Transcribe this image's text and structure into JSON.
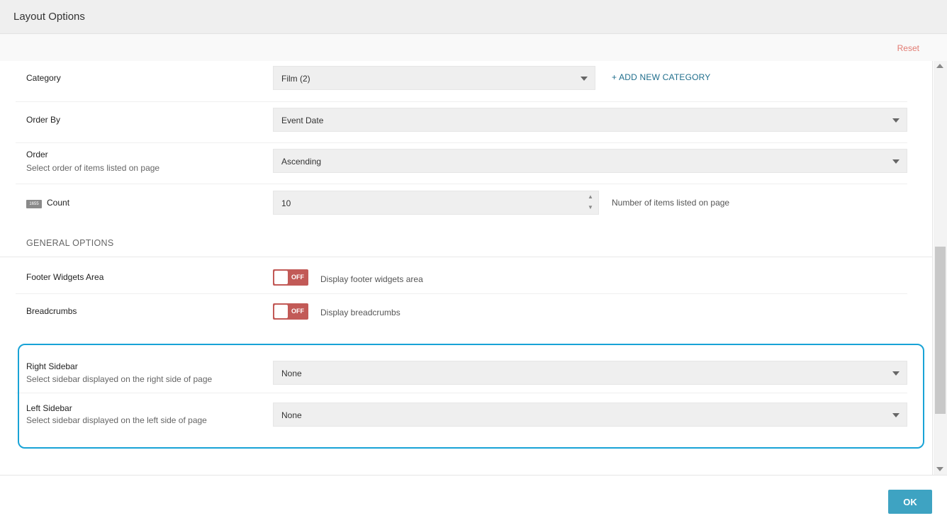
{
  "header": {
    "title": "Layout Options"
  },
  "toolbar": {
    "reset_label": "Reset"
  },
  "fields": {
    "category": {
      "label": "Category",
      "value": "Film  (2)",
      "add_label": "+ ADD NEW CATEGORY"
    },
    "order_by": {
      "label": "Order By",
      "value": "Event Date"
    },
    "order": {
      "label": "Order",
      "description": "Select order of items listed on page",
      "value": "Ascending"
    },
    "count": {
      "icon": "number-icon",
      "icon_text": "1655",
      "label": "Count",
      "value": "10",
      "note": "Number of items listed on page"
    }
  },
  "general_options": {
    "title": "GENERAL OPTIONS",
    "footer_widgets": {
      "label": "Footer Widgets Area",
      "state": "OFF",
      "description": "Display footer widgets area"
    },
    "breadcrumbs": {
      "label": "Breadcrumbs",
      "state": "OFF",
      "description": "Display breadcrumbs"
    }
  },
  "sidebars": {
    "right": {
      "label": "Right Sidebar",
      "description": "Select sidebar displayed on the right side of page",
      "value": "None"
    },
    "left": {
      "label": "Left Sidebar",
      "description": "Select sidebar displayed on the left side of page",
      "value": "None"
    }
  },
  "footer": {
    "ok_label": "OK"
  },
  "colors": {
    "accent": "#3ea3c2",
    "toggle_off": "#c25a57",
    "highlight": "#18a3d6",
    "link": "#1f6e8c",
    "reset": "#e27b72"
  }
}
